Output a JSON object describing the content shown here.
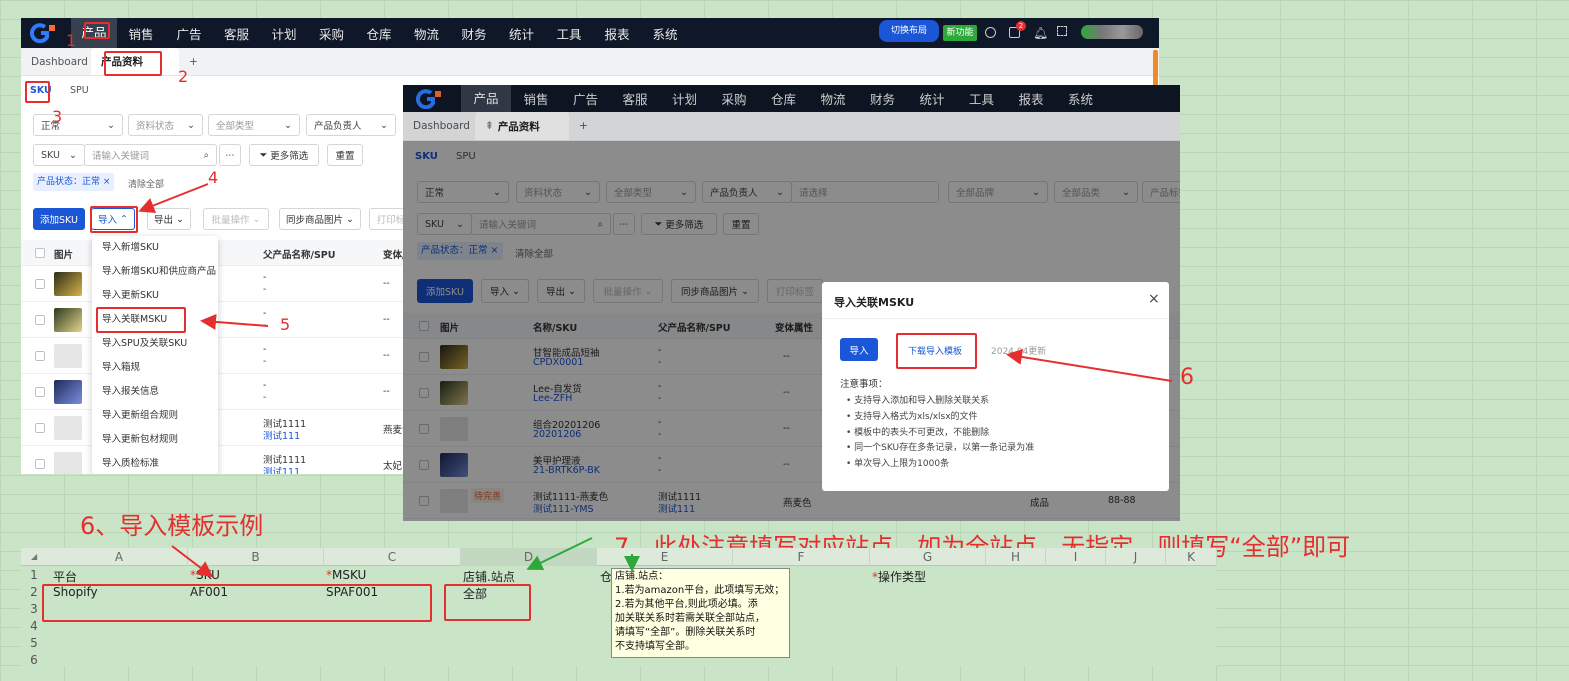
{
  "left_screen": {
    "nav": [
      "产品",
      "销售",
      "广告",
      "客服",
      "计划",
      "采购",
      "仓库",
      "物流",
      "财务",
      "统计",
      "工具",
      "报表",
      "系统"
    ],
    "switch_layout": "切换布局",
    "new_feature": "新功能",
    "bell_count": "2",
    "tabs": {
      "dashboard": "Dashboard",
      "product": "产品资料",
      "add": "+"
    },
    "subtabs": [
      "SKU",
      "SPU"
    ],
    "filters": {
      "status": "正常",
      "data_status": "资料状态",
      "type": "全部类型",
      "owner": "产品负责人",
      "search_prefix": "SKU",
      "search_placeholder": "请输入关键词",
      "more_filter": "更多筛选",
      "reset": "重置"
    },
    "tag": "产品状态：正常",
    "clear_all": "清除全部",
    "actions": {
      "add_sku": "添加SKU",
      "import": "导入",
      "export": "导出",
      "batch": "批量操作",
      "sync": "同步商品图片",
      "print": "打印标"
    },
    "table_headers": [
      "图片",
      "父产品名称/SPU",
      "变体属"
    ],
    "rows": [
      {
        "p1": "-",
        "p2": "-",
        "v": "--"
      },
      {
        "p1": "-",
        "p2": "-",
        "v": "--"
      },
      {
        "p1": "-",
        "p2": "-",
        "v": "--"
      },
      {
        "p1": "-",
        "p2": "-",
        "v": "--"
      },
      {
        "p1": "测试1111",
        "p2": "测试111",
        "v": "燕麦色"
      },
      {
        "p1": "测试1111",
        "p2": "测试111",
        "v": "太妃"
      }
    ],
    "import_menu": [
      "导入新增SKU",
      "导入新增SKU和供应商产品",
      "导入更新SKU",
      "导入关联MSKU",
      "导入SPU及关联SKU",
      "导入箱规",
      "导入报关信息",
      "导入更新组合规则",
      "导入更新包材规则",
      "导入质检标准"
    ]
  },
  "right_screen": {
    "nav": [
      "产品",
      "销售",
      "广告",
      "客服",
      "计划",
      "采购",
      "仓库",
      "物流",
      "财务",
      "统计",
      "工具",
      "报表",
      "系统"
    ],
    "tabs": {
      "dashboard": "Dashboard",
      "product": "产品资料",
      "add": "+"
    },
    "subtabs": [
      "SKU",
      "SPU"
    ],
    "filters": {
      "status": "正常",
      "data_status": "资料状态",
      "type": "全部类型",
      "owner": "产品负责人",
      "select_ph": "请选择",
      "brand": "全部品牌",
      "category": "全部品类",
      "tag_f": "产品标签",
      "search_prefix": "SKU",
      "search_placeholder": "请输入关键词",
      "more_filter": "更多筛选",
      "reset": "重置"
    },
    "tag": "产品状态：正常",
    "clear_all": "清除全部",
    "actions": {
      "add_sku": "添加SKU",
      "import": "导入",
      "export": "导出",
      "batch": "批量操作",
      "sync": "同步商品图片",
      "print": "打印标签"
    },
    "table_headers": [
      "图片",
      "名称/SKU",
      "父产品名称/SPU",
      "变体属性"
    ],
    "rows": [
      {
        "name": "甘智能成品短袖",
        "sku": "CPDX0001",
        "p1": "-",
        "p2": "-",
        "v": "--"
      },
      {
        "name": "Lee-自发货",
        "sku": "Lee-ZFH",
        "p1": "-",
        "p2": "-",
        "v": "--"
      },
      {
        "name": "组合20201206",
        "sku": "20201206",
        "p1": "-",
        "p2": "-",
        "v": "--"
      },
      {
        "name": "美甲护理液",
        "sku": "21-BRTK6P-BK",
        "p1": "-",
        "p2": "-",
        "v": "--"
      },
      {
        "badge": "待完善",
        "name": "测试1111-燕麦色",
        "sku": "测试111-YMS",
        "p1": "测试1111",
        "p2": "测试111",
        "v": "燕麦色",
        "extra1": "成品",
        "extra2": "88-88"
      }
    ],
    "modal": {
      "title": "导入关联MSKU",
      "import_btn": "导入",
      "download": "下载导入模板",
      "updated": "2024.04更新",
      "notes_title": "注意事项：",
      "notes": [
        "支持导入添加和导入删除关联关系",
        "支持导入格式为xls/xlsx的文件",
        "模板中的表头不可更改，不能删除",
        "同一个SKU存在多条记录，以第一条记录为准",
        "单次导入上限为1000条"
      ]
    }
  },
  "annotations": {
    "n1": "1",
    "n2": "2",
    "n3": "3",
    "n4": "4",
    "n5": "5",
    "n6": "6",
    "example_title": "6、导入模板示例",
    "note7": "7、此处注意填写对应站点，如为全站点，无指定，则填写“全部”即可"
  },
  "sheet": {
    "columns": [
      "A",
      "B",
      "C",
      "D",
      "E",
      "F",
      "G",
      "H",
      "I",
      "J",
      "K"
    ],
    "row_numbers": [
      "1",
      "2",
      "3",
      "4",
      "5",
      "6"
    ],
    "headers": {
      "A": "平台",
      "B": "SKU",
      "C": "MSKU",
      "D": "店铺.站点",
      "E": "仓",
      "G": "操作类型"
    },
    "row2": {
      "A": "Shopify",
      "B": "AF001",
      "C": "SPAF001",
      "D": "全部"
    },
    "comment": [
      "店铺.站点：",
      "1.若为amazon平台，此项填写无效；",
      "2.若为其他平台,则此项必填。添",
      "加关联关系时若需关联全部站点，",
      "请填写“全部”。删除关联关系时",
      "不支持填写全部。"
    ]
  },
  "colors": {
    "nav": "#0f1828",
    "primary": "#1a56d6",
    "red": "#e62e2e",
    "green": "#2ea83a"
  }
}
